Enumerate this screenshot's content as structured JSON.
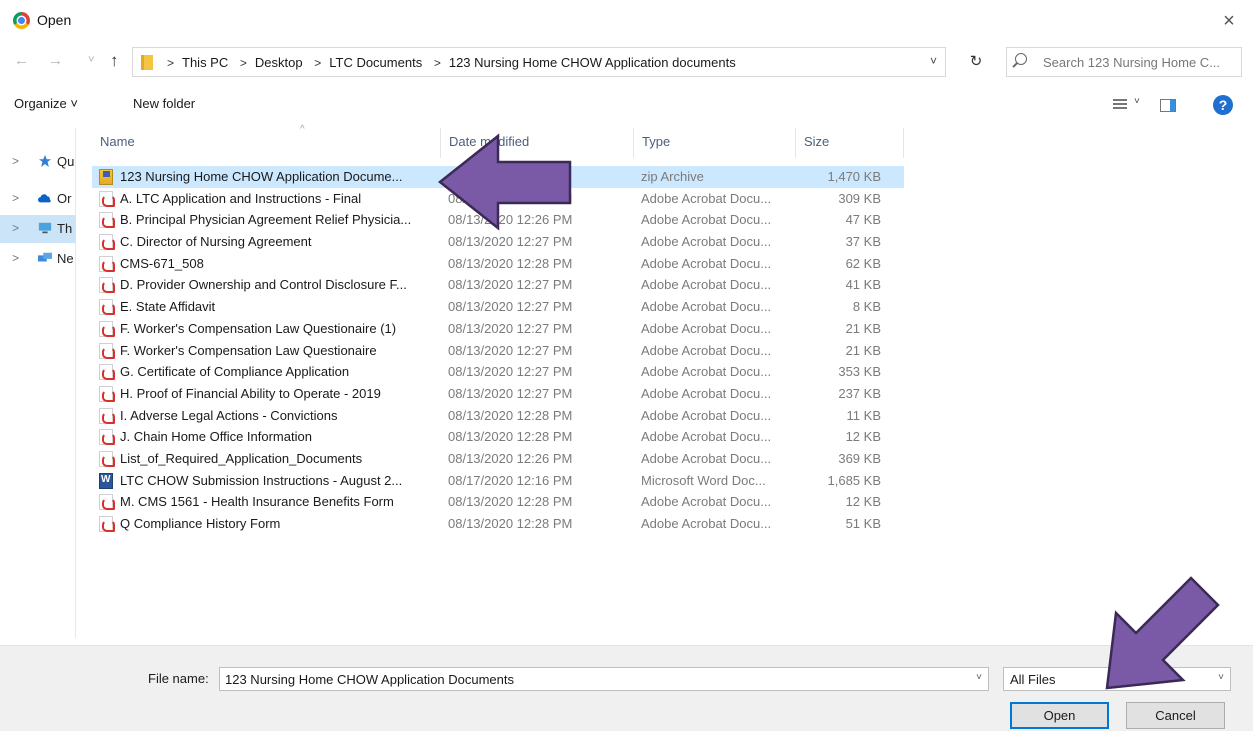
{
  "window": {
    "title": "Open",
    "close": "×"
  },
  "nav": {
    "back": "←",
    "forward": "→",
    "recent": "˅",
    "up": "↑",
    "breadcrumbs": [
      "This PC",
      "Desktop",
      "LTC Documents",
      "123 Nursing Home CHOW Application documents"
    ],
    "separator": ">",
    "dropdown": "˅",
    "refresh": "↻",
    "search_placeholder": "Search 123 Nursing Home C..."
  },
  "toolbar": {
    "organize": "Organize ˅",
    "new_folder": "New folder",
    "help": "?"
  },
  "navpane": {
    "items": [
      {
        "label": "Qu",
        "icon": "star-icon"
      },
      {
        "label": "Or",
        "icon": "cloud-icon"
      },
      {
        "label": "Th",
        "icon": "computer-icon"
      },
      {
        "label": "Ne",
        "icon": "network-icon"
      }
    ]
  },
  "columns": {
    "name": "Name",
    "date": "Date modified",
    "type": "Type",
    "size": "Size",
    "sort": "^"
  },
  "files": [
    {
      "name": "123 Nursing Home CHOW Application Docume...",
      "date": "AM",
      "type": "zip Archive",
      "size": "1,470 KB",
      "icon": "zip-icon",
      "selected": true
    },
    {
      "name": "A. LTC Application and Instructions - Final",
      "date": "08/13/2020 12:26 PM",
      "type": "Adobe Acrobat Docu...",
      "size": "309 KB",
      "icon": "pdf-icon"
    },
    {
      "name": "B. Principal Physician Agreement Relief Physicia...",
      "date": "08/13/2020 12:26 PM",
      "type": "Adobe Acrobat Docu...",
      "size": "47 KB",
      "icon": "pdf-icon"
    },
    {
      "name": "C. Director of Nursing Agreement",
      "date": "08/13/2020 12:27 PM",
      "type": "Adobe Acrobat Docu...",
      "size": "37 KB",
      "icon": "pdf-icon"
    },
    {
      "name": "CMS-671_508",
      "date": "08/13/2020 12:28 PM",
      "type": "Adobe Acrobat Docu...",
      "size": "62 KB",
      "icon": "pdf-icon"
    },
    {
      "name": "D. Provider Ownership and Control Disclosure F...",
      "date": "08/13/2020 12:27 PM",
      "type": "Adobe Acrobat Docu...",
      "size": "41 KB",
      "icon": "pdf-icon"
    },
    {
      "name": "E. State Affidavit",
      "date": "08/13/2020 12:27 PM",
      "type": "Adobe Acrobat Docu...",
      "size": "8 KB",
      "icon": "pdf-icon"
    },
    {
      "name": "F. Worker's Compensation Law Questionaire (1)",
      "date": "08/13/2020 12:27 PM",
      "type": "Adobe Acrobat Docu...",
      "size": "21 KB",
      "icon": "pdf-icon"
    },
    {
      "name": "F. Worker's Compensation Law Questionaire",
      "date": "08/13/2020 12:27 PM",
      "type": "Adobe Acrobat Docu...",
      "size": "21 KB",
      "icon": "pdf-icon"
    },
    {
      "name": "G. Certificate of Compliance Application",
      "date": "08/13/2020 12:27 PM",
      "type": "Adobe Acrobat Docu...",
      "size": "353 KB",
      "icon": "pdf-icon"
    },
    {
      "name": "H. Proof of Financial Ability to Operate - 2019",
      "date": "08/13/2020 12:27 PM",
      "type": "Adobe Acrobat Docu...",
      "size": "237 KB",
      "icon": "pdf-icon"
    },
    {
      "name": "I. Adverse Legal Actions - Convictions",
      "date": "08/13/2020 12:28 PM",
      "type": "Adobe Acrobat Docu...",
      "size": "11 KB",
      "icon": "pdf-icon"
    },
    {
      "name": "J. Chain Home Office Information",
      "date": "08/13/2020 12:28 PM",
      "type": "Adobe Acrobat Docu...",
      "size": "12 KB",
      "icon": "pdf-icon"
    },
    {
      "name": "List_of_Required_Application_Documents",
      "date": "08/13/2020 12:26 PM",
      "type": "Adobe Acrobat Docu...",
      "size": "369 KB",
      "icon": "pdf-icon"
    },
    {
      "name": "LTC CHOW Submission Instructions - August 2...",
      "date": "08/17/2020 12:16 PM",
      "type": "Microsoft Word Doc...",
      "size": "1,685 KB",
      "icon": "word-icon"
    },
    {
      "name": "M. CMS 1561 - Health Insurance Benefits Form",
      "date": "08/13/2020 12:28 PM",
      "type": "Adobe Acrobat Docu...",
      "size": "12 KB",
      "icon": "pdf-icon"
    },
    {
      "name": "Q Compliance History Form",
      "date": "08/13/2020 12:28 PM",
      "type": "Adobe Acrobat Docu...",
      "size": "51 KB",
      "icon": "pdf-icon"
    }
  ],
  "footer": {
    "file_name_label": "File name:",
    "file_name_value": "123 Nursing Home CHOW Application Documents",
    "file_type_value": "All Files",
    "dropdown": "˅",
    "open": "Open",
    "cancel": "Cancel"
  },
  "annotations": {
    "arrow_color": "#7a5aa6"
  }
}
